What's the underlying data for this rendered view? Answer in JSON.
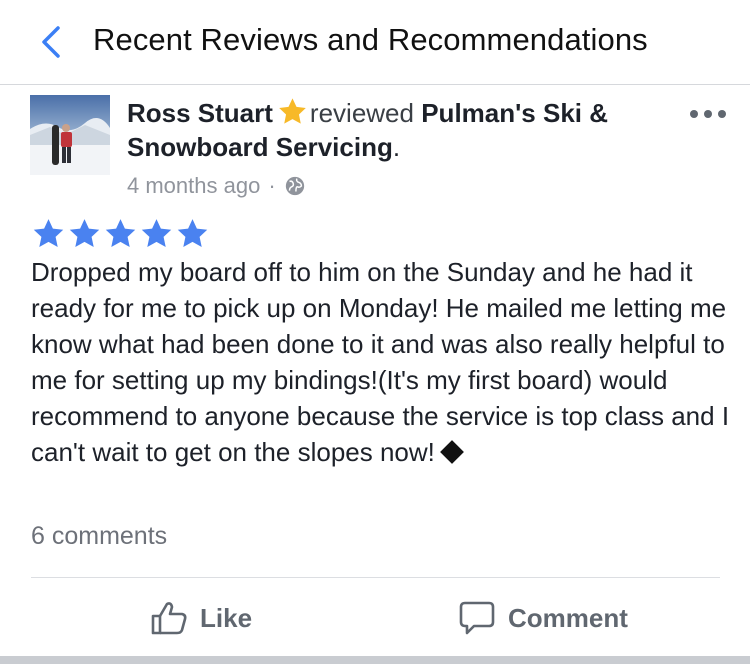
{
  "header": {
    "title": "Recent Reviews and Recommendations",
    "back_icon": "chevron-left-icon",
    "accent_color": "#3b7ff5"
  },
  "review": {
    "reviewer_name": "Ross Stuart",
    "verb": "reviewed",
    "page_name": "Pulman's Ski & Snowboard Servicing",
    "period": ".",
    "time_ago": "4 months ago",
    "separator": "·",
    "audience_icon": "globe-icon",
    "rating": 5,
    "rating_max": 5,
    "star_color": "#4a82f0",
    "badge_star_color": "#f7b928",
    "text": "Dropped my board off to him on the Sunday and he had it ready for me to pick up on Monday! He mailed me letting me know what had been done to it and was also really helpful to me for setting up my bindings!(It's my first board) would recommend to anyone because the service is top class and I can't wait to get on the slopes now!",
    "emoji_icon": "black-diamond-emoji-icon",
    "comments_count_label": "6 comments"
  },
  "actions": {
    "like_label": "Like",
    "comment_label": "Comment"
  }
}
